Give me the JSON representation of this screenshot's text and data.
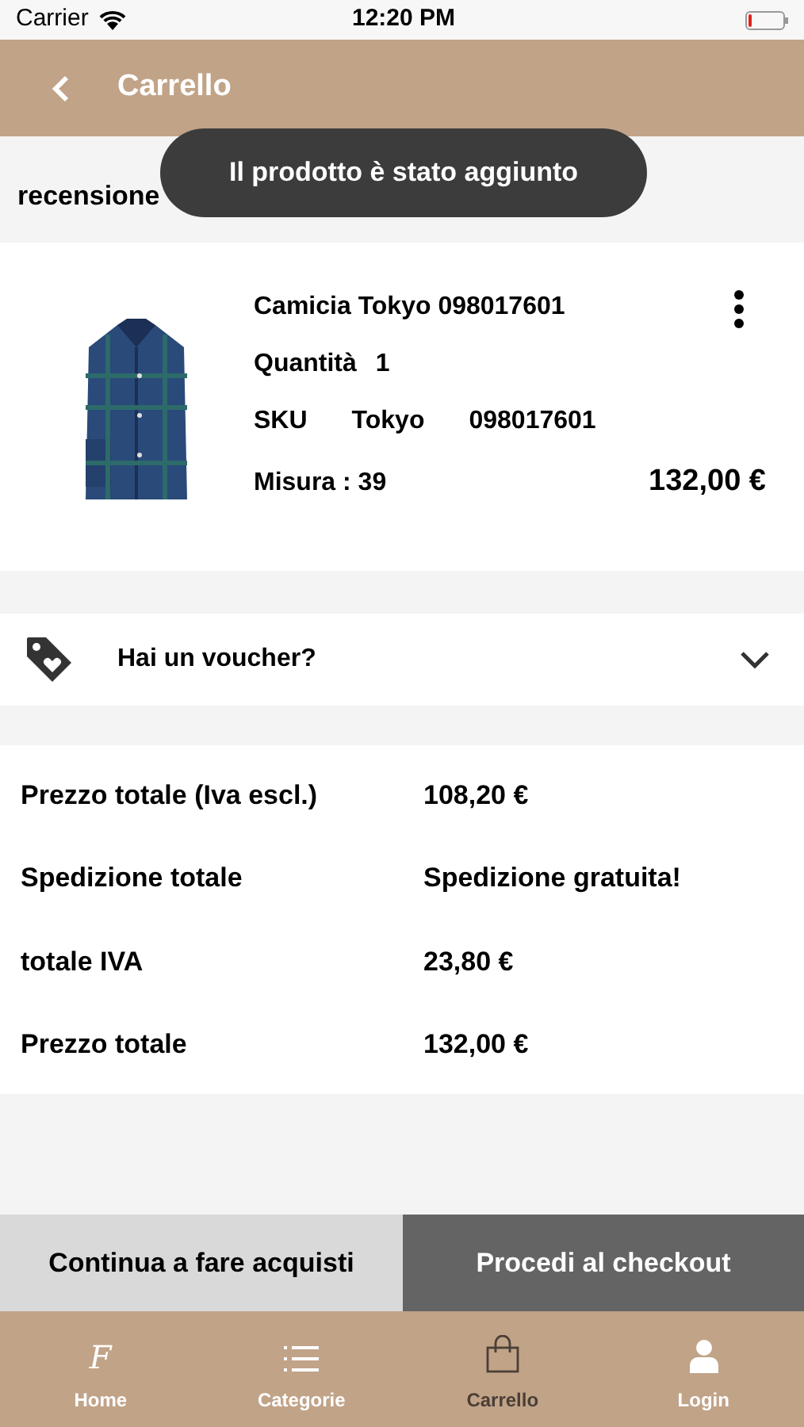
{
  "status_bar": {
    "carrier": "Carrier",
    "time": "12:20 PM"
  },
  "header": {
    "title": "Carrello"
  },
  "section_title": "recensione",
  "toast": "Il prodotto è stato aggiunto",
  "cart_items": [
    {
      "kind": "picture",
      "name": "Camicia Tokyo 098017601",
      "quantity_label": "Quantità",
      "quantity": "1",
      "sku_label": "SKU",
      "sku_parts": [
        "Tokyo",
        "098017601"
      ],
      "size": "Misura : 39",
      "price": "132,00 €"
    }
  ],
  "voucher": {
    "label": "Hai un voucher?",
    "expanded": false
  },
  "totals": [
    {
      "label": "Prezzo totale (Iva escl.)",
      "value": "108,20 €"
    },
    {
      "label": "Spedizione totale",
      "value": "Spedizione gratuita!"
    },
    {
      "label": "totale IVA",
      "value": "23,80 €"
    },
    {
      "label": "Prezzo totale",
      "value": "132,00 €"
    }
  ],
  "actions": [
    {
      "label": "Continua a fare acquisti",
      "kind": "secondary"
    },
    {
      "label": "Procedi al checkout",
      "kind": "primary"
    }
  ],
  "tab_bar": [
    {
      "label": "Home",
      "kind": "logo",
      "logo_text": "F",
      "selected": false
    },
    {
      "label": "Categorie",
      "kind": "list",
      "selected": false
    },
    {
      "label": "Carrello",
      "kind": "bag",
      "selected": true
    },
    {
      "label": "Login",
      "kind": "user",
      "selected": false
    }
  ]
}
